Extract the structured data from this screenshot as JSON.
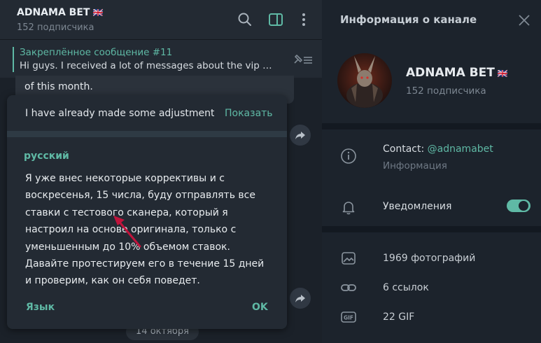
{
  "chat": {
    "title": "ADNAMA BET",
    "flag": "🇬🇧",
    "subtitle": "152 подписчика",
    "pinned_title": "Закреплённое сообщение #11",
    "pinned_text": "Hi guys.  I received a lot of messages about the vip c...",
    "message_fragment": "of this month.",
    "date_pill": "14 октября"
  },
  "dialog": {
    "original_text": "I have already made some adjustments and from Sunday",
    "show_label": "Показать",
    "language": "русский",
    "translation": "Я уже внес некоторые коррективы и с воскресенья, 15 числа, буду отправлять все ставки с тестового сканера, который я настроил на основе оригинала, только с уменьшенным до 10% объемом ставок. Давайте протестируем его в течение 15 дней и проверим, как он себя поведет.",
    "language_button": "Язык",
    "ok_button": "OK"
  },
  "panel": {
    "title": "Информация о канале",
    "channel_name": "ADNAMA BET",
    "flag": "🇬🇧",
    "subscribers": "152 подписчика",
    "contact_prefix": "Contact: ",
    "contact_handle": "@adnamabet",
    "contact_sub": "Информация",
    "notifications_label": "Уведомления",
    "notifications_on": true,
    "media": [
      {
        "icon": "photo-icon",
        "label": "1969 фотографий"
      },
      {
        "icon": "link-icon",
        "label": "6 ссылок"
      },
      {
        "icon": "gif-icon",
        "label": "22 GIF"
      }
    ]
  },
  "colors": {
    "accent": "#5fb9a5",
    "background": "#1b2129",
    "panel": "#1c232c"
  }
}
